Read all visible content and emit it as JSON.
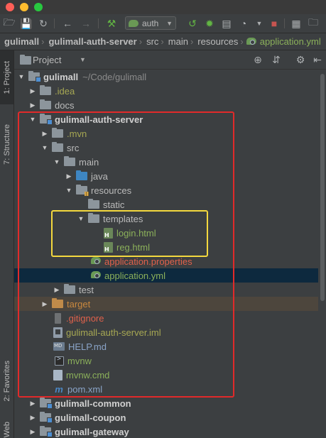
{
  "toolbar": {
    "run_config": "auth"
  },
  "breadcrumb": [
    {
      "label": "gulimall",
      "bold": true
    },
    {
      "label": "gulimall-auth-server",
      "bold": true
    },
    {
      "label": "src"
    },
    {
      "label": "main"
    },
    {
      "label": "resources"
    },
    {
      "label": "application.yml",
      "green": true
    }
  ],
  "left_strip": {
    "project_tab": "1: Project",
    "structure_tab": "7: Structure",
    "favorites_tab": "2: Favorites",
    "web_tab": "Web"
  },
  "panel": {
    "title": "Project"
  },
  "tree": {
    "root": {
      "name": "gulimall",
      "path": "~/Code/gulimall"
    },
    "idea": ".idea",
    "docs": "docs",
    "auth_server": "gulimall-auth-server",
    "mvn": ".mvn",
    "src": "src",
    "main": "main",
    "java": "java",
    "resources": "resources",
    "static": "static",
    "templates": "templates",
    "login_html": "login.html",
    "reg_html": "reg.html",
    "app_properties": "application.properties",
    "app_yml": "application.yml",
    "test": "test",
    "target": "target",
    "gitignore": ".gitignore",
    "iml": "gulimall-auth-server.iml",
    "help_md": "HELP.md",
    "mvnw": "mvnw",
    "mvnw_cmd": "mvnw.cmd",
    "pom": "pom.xml",
    "common": "gulimall-common",
    "coupon": "gulimall-coupon",
    "gateway": "gulimall-gateway"
  },
  "colors": {
    "selected_row": "#0d293e",
    "excluded_row": "#4d463d",
    "highlight_red": "#e12a2a",
    "highlight_yellow": "#f4d83e"
  }
}
